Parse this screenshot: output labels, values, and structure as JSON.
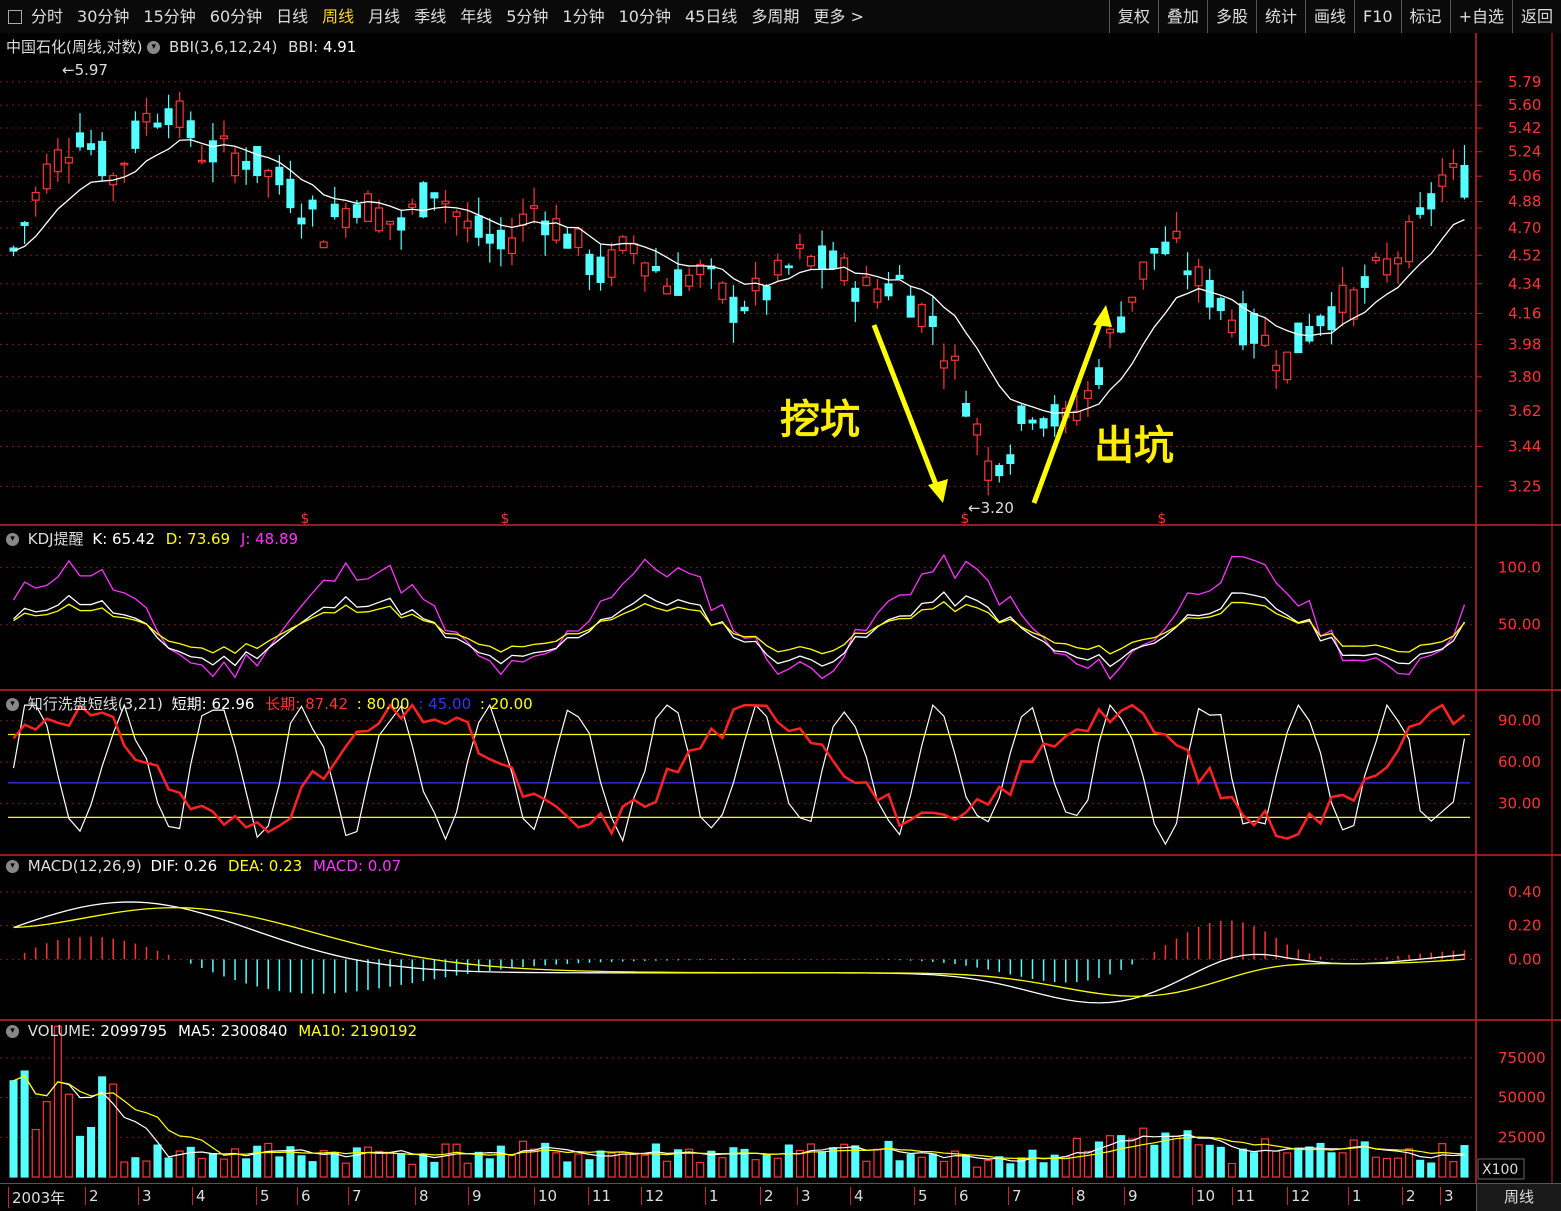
{
  "toolbar": {
    "periods": [
      "分时",
      "30分钟",
      "15分钟",
      "60分钟",
      "日线",
      "周线",
      "月线",
      "季线",
      "年线",
      "5分钟",
      "1分钟",
      "10分钟",
      "45日线",
      "多周期",
      "更多 >"
    ],
    "active": "周线",
    "right_buttons": [
      "复权",
      "叠加",
      "多股",
      "统计",
      "画线",
      "F10",
      "标记",
      "+自选",
      "返回"
    ]
  },
  "main_pane": {
    "stock": "中国石化(周线,对数)",
    "indicator": "BBI(3,6,12,24)",
    "bbi_label": "BBI: ",
    "bbi_value": "4.91",
    "high_mark": "5.97",
    "low_mark": "3.20",
    "price_ticks": [
      "5.79",
      "5.60",
      "5.42",
      "5.24",
      "5.06",
      "4.88",
      "4.70",
      "4.52",
      "4.34",
      "4.16",
      "3.98",
      "3.80",
      "3.62",
      "3.44",
      "3.25"
    ],
    "annotations": {
      "dig": "挖坑",
      "exit": "出坑"
    }
  },
  "kdj_pane": {
    "name": "KDJ提醒",
    "k_label": "K: ",
    "k": "65.42",
    "d_label": "D: ",
    "d": "73.69",
    "j_label": "J: ",
    "j": "48.89",
    "ticks": [
      "100.0",
      "50.00"
    ]
  },
  "wash_pane": {
    "name": "知行洗盘短线(3,21)",
    "short_label": "短期: ",
    "short": "62.96",
    "long_label": "长期: ",
    "long": "87.42",
    "l80": ": 80.00",
    "l45": ": 45.00",
    "l20": ": 20.00",
    "ticks": [
      "90.00",
      "60.00",
      "30.00"
    ]
  },
  "macd_pane": {
    "name": "MACD(12,26,9)",
    "dif_label": "DIF: ",
    "dif": "0.26",
    "dea_label": "DEA: ",
    "dea": "0.23",
    "macd_label": "MACD: ",
    "macd": "0.07",
    "ticks": [
      "0.40",
      "0.20",
      "0.00"
    ]
  },
  "volume_pane": {
    "vol_label": "VOLUME: ",
    "vol": "2099795",
    "ma5_label": "MA5: ",
    "ma5": "2300840",
    "ma10_label": "MA10: ",
    "ma10": "2190192",
    "ticks": [
      "75000",
      "50000",
      "25000"
    ],
    "unit": "X100"
  },
  "time_axis": {
    "labels": [
      "2003年",
      "2",
      "3",
      "4",
      "5",
      "6",
      "7",
      "8",
      "9",
      "10",
      "11",
      "12",
      "1",
      "2",
      "3",
      "4",
      "5",
      "6",
      "7",
      "8",
      "9",
      "10",
      "11",
      "12",
      "1",
      "2",
      "3"
    ],
    "period_tag": "周线"
  },
  "colors": {
    "up": "#ff3333",
    "down": "#54ffff",
    "ma": "#ffffff",
    "yellow": "#ffff00",
    "magenta": "#ff33ff",
    "blue": "#3333ff",
    "grid": "#7a1a1a"
  }
}
